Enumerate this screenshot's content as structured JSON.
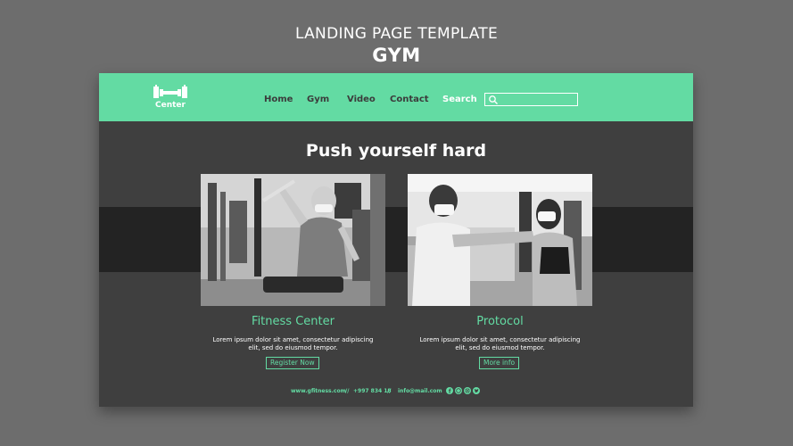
{
  "poster": {
    "subtitle": "LANDING PAGE TEMPLATE",
    "title": "GYM"
  },
  "colors": {
    "accent": "#63dba3",
    "background": "#6d6d6d",
    "page": "#3f3f3f",
    "band": "#232323"
  },
  "navbar": {
    "logo_text": "Center",
    "logo_icon": "dumbbell-icon",
    "items": [
      {
        "label": "Home"
      },
      {
        "label": "Gym"
      },
      {
        "label": "Video"
      },
      {
        "label": "Contact"
      },
      {
        "label": "Search"
      }
    ],
    "search": {
      "icon": "search-icon",
      "value": ""
    }
  },
  "main": {
    "headline": "Push yourself hard",
    "cards": [
      {
        "title": "Fitness Center",
        "description_line1": "Lorem ipsum dolor sit amet, consectetur adipiscing",
        "description_line2": "elit, sed do eiusmod tempor.",
        "button": "Register Now"
      },
      {
        "title": "Protocol",
        "description_line1": "Lorem ipsum dolor sit amet, consectetur adipiscing",
        "description_line2": "elit, sed do eiusmod tempor.",
        "button": "More info"
      }
    ]
  },
  "footer": {
    "website": "www.gfitness.com",
    "separator": "//",
    "phone": "+997 834 18",
    "email": "info@mail.com",
    "social_icons": [
      "facebook-icon",
      "whatsapp-icon",
      "instagram-icon",
      "twitter-icon"
    ]
  }
}
